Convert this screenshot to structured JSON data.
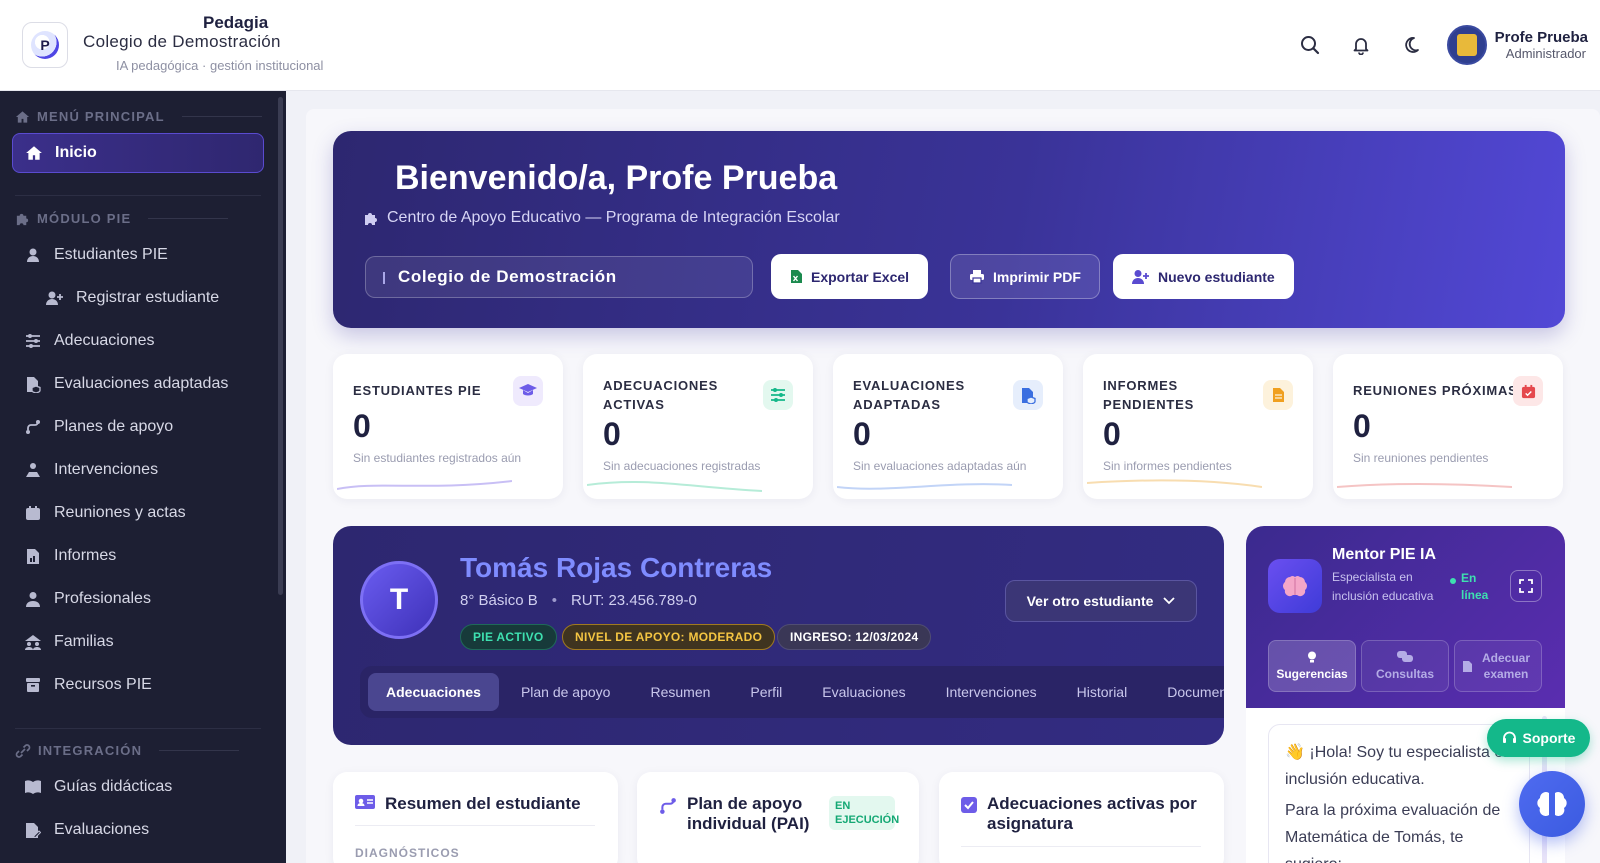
{
  "header": {
    "brand_title": "Pedagia",
    "school": "Colegio de Demostración",
    "tagline": "IA pedagógica · gestión institucional",
    "user_name": "Profe Prueba",
    "user_role": "Administrador"
  },
  "sidebar": {
    "section_main": "MENÚ PRINCIPAL",
    "home": "Inicio",
    "section_pie": "MÓDULO PIE",
    "items": [
      "Estudiantes PIE",
      "Registrar estudiante",
      "Adecuaciones",
      "Evaluaciones adaptadas",
      "Planes de apoyo",
      "Intervenciones",
      "Reuniones y actas",
      "Informes",
      "Profesionales",
      "Familias",
      "Recursos PIE"
    ],
    "section_integration": "INTEGRACIÓN",
    "integration_items": [
      "Guías didácticas",
      "Evaluaciones"
    ]
  },
  "hero": {
    "title": "Bienvenido/a, Profe Prueba",
    "subtitle": "Centro de Apoyo Educativo — Programa de Integración Escolar",
    "school_value": "Colegio de Demostración",
    "btn_excel": "Exportar Excel",
    "btn_pdf": "Imprimir PDF",
    "btn_new": "Nuevo estudiante"
  },
  "stats": [
    {
      "label": "ESTUDIANTES PIE",
      "value": "0",
      "note": "Sin estudiantes registrados aún",
      "color": "#6d5ce8"
    },
    {
      "label": "ADECUACIONES ACTIVAS",
      "value": "0",
      "note": "Sin adecuaciones registradas",
      "color": "#14b88a"
    },
    {
      "label": "EVALUACIONES ADAPTADAS",
      "value": "0",
      "note": "Sin evaluaciones adaptadas aún",
      "color": "#3b6fe0"
    },
    {
      "label": "INFORMES PENDIENTES",
      "value": "0",
      "note": "Sin informes pendientes",
      "color": "#f0a020"
    },
    {
      "label": "REUNIONES PRÓXIMAS",
      "value": "0",
      "note": "Sin reuniones pendientes",
      "color": "#e5484d"
    }
  ],
  "student": {
    "initial": "T",
    "name": "Tomás Rojas Contreras",
    "grade": "8° Básico B",
    "rut": "RUT: 23.456.789-0",
    "chip_pie": "PIE ACTIVO",
    "chip_level": "NIVEL DE APOYO: MODERADO",
    "chip_ingreso": "INGRESO: 12/03/2024",
    "ver_otro": "Ver otro estudiante",
    "tabs": [
      "Adecuaciones",
      "Plan de apoyo",
      "Resumen",
      "Perfil",
      "Evaluaciones",
      "Intervenciones",
      "Historial",
      "Documen"
    ]
  },
  "mentor": {
    "title": "Mentor PIE IA",
    "subtitle": "Especialista en inclusión educativa",
    "status": "En línea",
    "tabs": [
      "Sugerencias",
      "Consultas",
      "Adecuar examen"
    ],
    "message_1": "👋 ¡Hola! Soy tu especialista en inclusión educativa.",
    "message_2": "Para la próxima evaluación de Matemática de Tomás, te sugiero:"
  },
  "support": "Soporte",
  "cards": {
    "resumen_title": "Resumen del estudiante",
    "resumen_label": "DIAGNÓSTICOS",
    "pai_title": "Plan de apoyo individual (PAI)",
    "pai_badge": "EN EJECUCIÓN",
    "adec_title": "Adecuaciones activas por asignatura"
  }
}
